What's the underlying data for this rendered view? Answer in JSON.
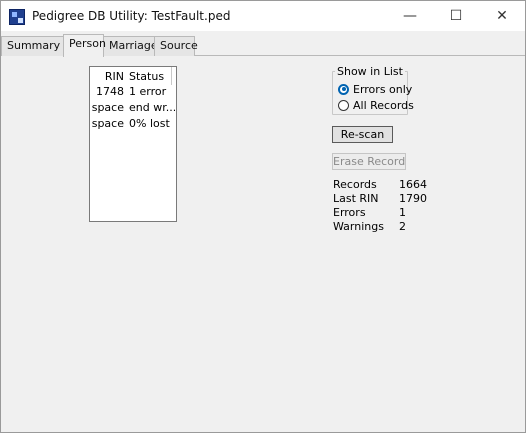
{
  "window": {
    "title": "Pedigree DB Utility: TestFault.ped",
    "controls": {
      "minimize": "—",
      "maximize": "☐",
      "close": "✕"
    }
  },
  "tabs": [
    {
      "label": "Summary",
      "active": false
    },
    {
      "label": "Person",
      "active": true
    },
    {
      "label": "Marriage",
      "active": false
    },
    {
      "label": "Source",
      "active": false
    }
  ],
  "list": {
    "columns": {
      "rin": "RIN",
      "status": "Status"
    },
    "rows": [
      {
        "rin": "1748",
        "status": "1 error"
      },
      {
        "rin": "space",
        "status": "end wr..."
      },
      {
        "rin": "space",
        "status": "0% lost"
      }
    ]
  },
  "show_in_list": {
    "legend": "Show in List",
    "options": [
      {
        "label": "Errors only",
        "selected": true
      },
      {
        "label": "All Records",
        "selected": false
      }
    ]
  },
  "buttons": {
    "rescan": "Re-scan",
    "erase": "Erase Record"
  },
  "stats": [
    {
      "label": "Records",
      "value": "1664"
    },
    {
      "label": "Last RIN",
      "value": "1790"
    },
    {
      "label": "Errors",
      "value": "1"
    },
    {
      "label": "Warnings",
      "value": "2"
    }
  ],
  "colors": {
    "accent": "#0063b1",
    "app_icon": "#1f3f8f"
  },
  "icons": {
    "app": "app-icon"
  }
}
